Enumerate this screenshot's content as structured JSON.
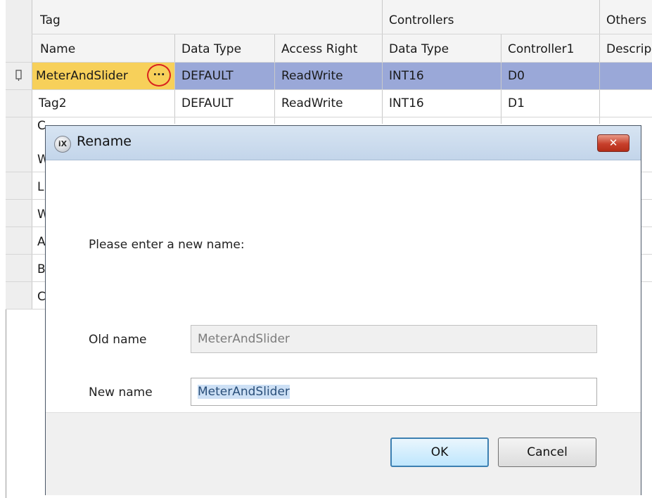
{
  "grid": {
    "group_headers": [
      "Tag",
      "Controllers",
      "Others"
    ],
    "column_headers": [
      "Name",
      "Data Type",
      "Access Right",
      "Data Type",
      "Controller1",
      "Descrip"
    ],
    "rows": [
      [
        "MeterAndSlider",
        "DEFAULT",
        "ReadWrite",
        "INT16",
        "D0",
        ""
      ],
      [
        "Tag2",
        "DEFAULT",
        "ReadWrite",
        "INT16",
        "D1",
        ""
      ]
    ],
    "partial_row_initials": [
      "C",
      "W",
      "L",
      "W",
      "A",
      "B",
      "C"
    ],
    "ellipsis": "···"
  },
  "dialog": {
    "icon_text": "iX",
    "title": "Rename",
    "close_glyph": "✕",
    "prompt": "Please enter a new name:",
    "old_name_label": "Old name",
    "old_name_value": "MeterAndSlider",
    "new_name_label": "New name",
    "new_name_value": "MeterAndSlider",
    "ok_label": "OK",
    "cancel_label": "Cancel"
  },
  "colors": {
    "selected_row": "#9aa8d8",
    "current_cell": "#f7d05a",
    "highlight_circle": "#d9221f",
    "close_button": "#c7402b"
  }
}
